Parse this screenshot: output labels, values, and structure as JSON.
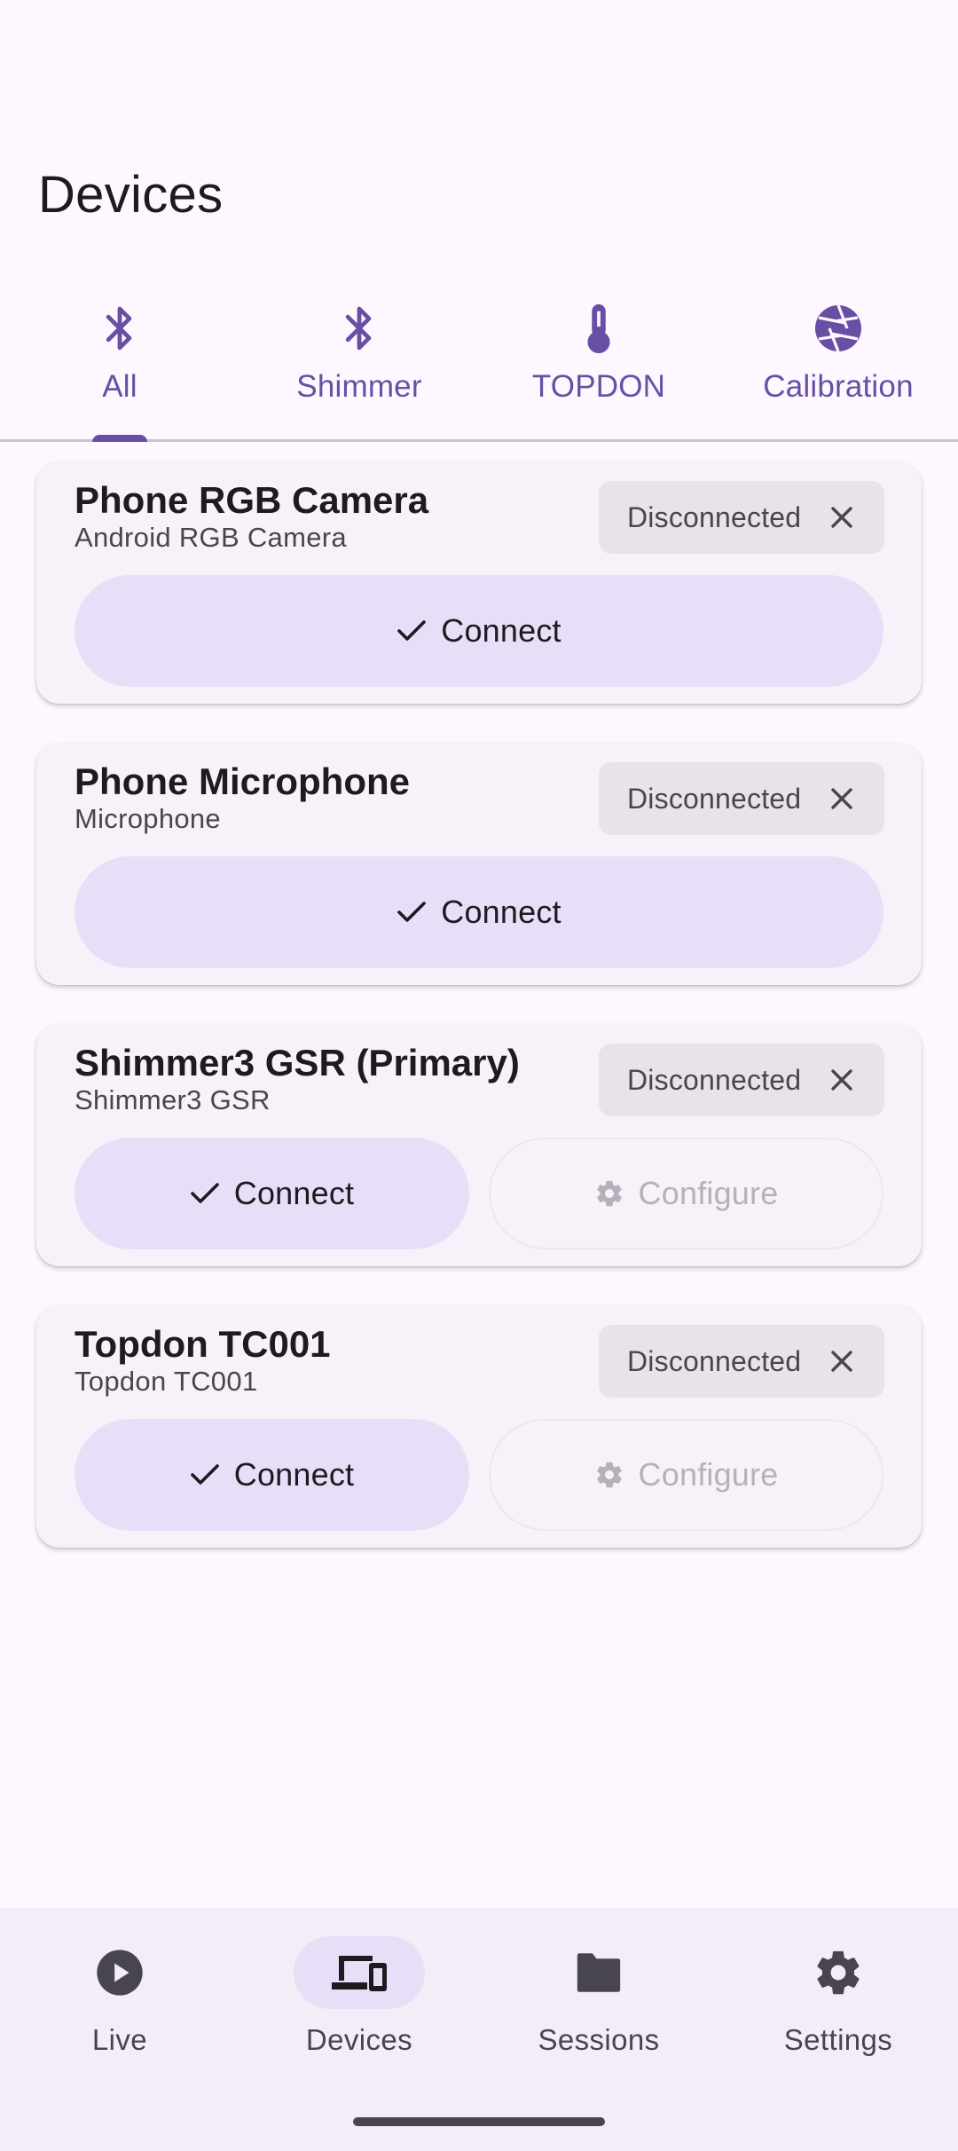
{
  "page": {
    "title": "Devices"
  },
  "tabs": [
    {
      "label": "All",
      "icon": "bluetooth-icon",
      "selected": true
    },
    {
      "label": "Shimmer",
      "icon": "bluetooth-icon",
      "selected": false
    },
    {
      "label": "TOPDON",
      "icon": "thermometer-icon",
      "selected": false
    },
    {
      "label": "Calibration",
      "icon": "camera-aperture-icon",
      "selected": false
    }
  ],
  "devices": [
    {
      "name": "Phone RGB Camera",
      "type": "Android RGB Camera",
      "status": "Disconnected",
      "connect_label": "Connect"
    },
    {
      "name": "Phone Microphone",
      "type": "Microphone",
      "status": "Disconnected",
      "connect_label": "Connect"
    },
    {
      "name": "Shimmer3 GSR (Primary)",
      "type": "Shimmer3 GSR",
      "status": "Disconnected",
      "connect_label": "Connect",
      "configure_label": "Configure"
    },
    {
      "name": "Topdon TC001",
      "type": "Topdon TC001",
      "status": "Disconnected",
      "connect_label": "Connect",
      "configure_label": "Configure"
    }
  ],
  "bottom_nav": [
    {
      "label": "Live",
      "icon": "play-circle-icon",
      "active": false
    },
    {
      "label": "Devices",
      "icon": "devices-icon",
      "active": true
    },
    {
      "label": "Sessions",
      "icon": "folder-icon",
      "active": false
    },
    {
      "label": "Settings",
      "icon": "gear-icon",
      "active": false
    }
  ],
  "colors": {
    "background": "#fef7ff",
    "primary": "#6750a4",
    "card": "#f7f2fa",
    "connect_button": "#e8def8",
    "chip": "#e8e2ea",
    "nav_bar": "#f3edf7"
  }
}
